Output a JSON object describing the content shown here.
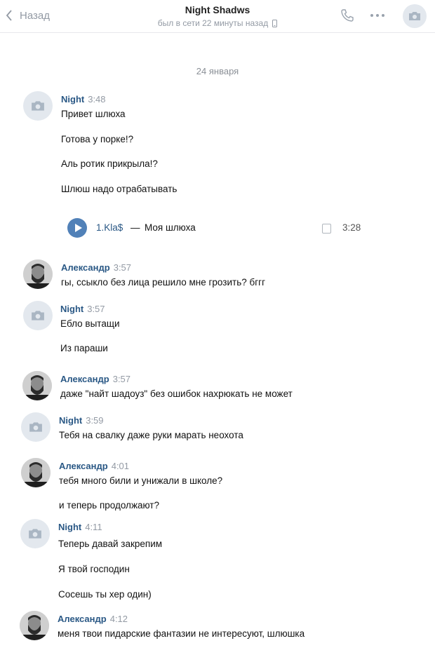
{
  "header": {
    "back_label": "Назад",
    "title": "Night Shadws",
    "status": "был в сети 22 минуты назад"
  },
  "date_separator": "24 января",
  "messages": [
    {
      "author": "Night",
      "time": "3:48",
      "avatar": "camera-icon",
      "lines": [
        "Привет шлюха",
        "Готова у порке!?",
        "Аль ротик прикрыла!?",
        "Шлюш надо отрабатывать"
      ],
      "audio": {
        "artist": "1.Kla$",
        "separator": "—",
        "title": "Моя шлюха",
        "duration": "3:28"
      }
    },
    {
      "author": "Александр",
      "time": "3:57",
      "avatar": "user-photo",
      "lines": [
        "гы, ссыкло без лица решило мне грозить? бггг"
      ]
    },
    {
      "author": "Night",
      "time": "3:57",
      "avatar": "camera-icon",
      "lines": [
        "Ебло вытащи",
        "Из параши"
      ]
    },
    {
      "author": "Александр",
      "time": "3:57",
      "avatar": "user-photo",
      "lines": [
        "даже \"найт шадоуз\" без ошибок нахрюкать не может"
      ]
    },
    {
      "author": "Night",
      "time": "3:59",
      "avatar": "camera-icon",
      "lines": [
        "Тебя на свалку даже руки марать неохота"
      ]
    },
    {
      "author": "Александр",
      "time": "4:01",
      "avatar": "user-photo",
      "lines": [
        "тебя много били и унижали в школе?",
        "и теперь продолжают?"
      ]
    },
    {
      "author": "Night",
      "time": "4:11",
      "avatar": "camera-icon",
      "lines": [
        "Теперь давай закрепим",
        "Я твой господин",
        "Сосешь ты хер один)"
      ]
    },
    {
      "author": "Александр",
      "time": "4:12",
      "avatar": "user-photo",
      "lines": [
        "меня твои пидарские фантазии не интересуют, шлюшка"
      ]
    }
  ]
}
